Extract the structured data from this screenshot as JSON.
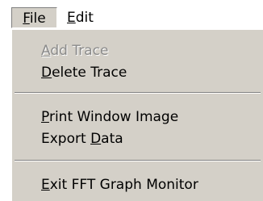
{
  "menubar": {
    "file": {
      "accel": "F",
      "rest": "ile"
    },
    "edit": {
      "accel": "E",
      "rest": "dit"
    }
  },
  "file_menu": {
    "items": [
      {
        "accel": "A",
        "rest": "dd Trace",
        "enabled": false
      },
      {
        "accel": "D",
        "rest": "elete Trace",
        "enabled": true
      },
      {
        "accel": "P",
        "rest": "rint Window Image",
        "enabled": true
      },
      {
        "before": "Export ",
        "accel": "D",
        "rest": "ata",
        "enabled": true
      },
      {
        "accel": "E",
        "rest": "xit FFT Graph Monitor",
        "enabled": true
      }
    ]
  },
  "colors": {
    "menu_background": "#d4d0c8",
    "disabled_text": "#8a8a8a",
    "text": "#000000"
  }
}
